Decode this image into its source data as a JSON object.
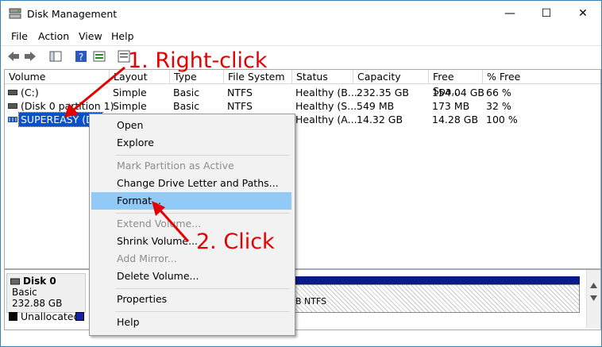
{
  "window": {
    "title": "Disk Management",
    "controls": {
      "minimize": "—",
      "maximize": "☐",
      "close": "✕"
    }
  },
  "menubar": [
    "File",
    "Action",
    "View",
    "Help"
  ],
  "toolbar": {
    "icons": [
      "back-icon",
      "forward-icon",
      "console-tree-icon",
      "help-icon",
      "properties-icon",
      "refresh-icon"
    ]
  },
  "volume_table": {
    "headers": [
      "Volume",
      "Layout",
      "Type",
      "File System",
      "Status",
      "Capacity",
      "Free Spa...",
      "% Free"
    ],
    "rows": [
      [
        "(C:)",
        "Simple",
        "Basic",
        "NTFS",
        "Healthy (B...",
        "232.35 GB",
        "154.04 GB",
        "66 %"
      ],
      [
        "(Disk 0 partition 1)",
        "Simple",
        "Basic",
        "NTFS",
        "Healthy (S...",
        "549 MB",
        "173 MB",
        "32 %"
      ],
      [
        "SUPEREASY (D:)",
        "",
        "",
        "",
        "Healthy (A...",
        "14.32 GB",
        "14.28 GB",
        "100 %"
      ]
    ]
  },
  "disk_panel": {
    "name": "Disk 0",
    "type": "Basic",
    "size": "232.88 GB",
    "partition_fragment": "B NTFS",
    "legend_unallocated": "Unallocated"
  },
  "context_menu": {
    "items": [
      {
        "label": "Open",
        "enabled": true
      },
      {
        "label": "Explore",
        "enabled": true
      },
      {
        "label": "Mark Partition as Active",
        "enabled": false
      },
      {
        "label": "Change Drive Letter and Paths...",
        "enabled": true
      },
      {
        "label": "Format...",
        "enabled": true,
        "highlighted": true
      },
      {
        "label": "Extend Volume...",
        "enabled": false
      },
      {
        "label": "Shrink Volume...",
        "enabled": true
      },
      {
        "label": "Add Mirror...",
        "enabled": false
      },
      {
        "label": "Delete Volume...",
        "enabled": true
      },
      {
        "label": "Properties",
        "enabled": true
      },
      {
        "label": "Help",
        "enabled": true
      }
    ]
  },
  "annotations": {
    "step1": "1. Right-click",
    "step2": "2. Click",
    "color": "#e30000"
  }
}
